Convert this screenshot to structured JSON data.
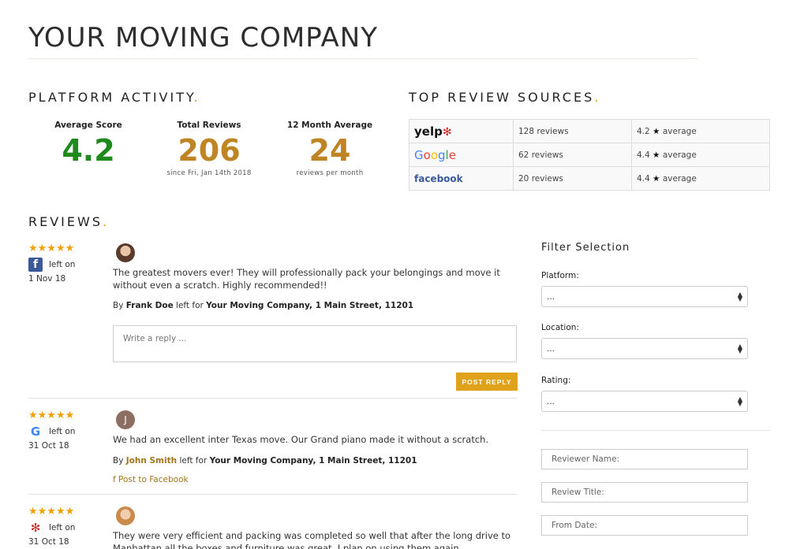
{
  "company": {
    "title": "YOUR MOVING COMPANY"
  },
  "platform_activity": {
    "title": "PLATFORM ACTIVITY",
    "stats": [
      {
        "label": "Average Score",
        "value": "4.2",
        "sub": "",
        "color": "#1e8a1e"
      },
      {
        "label": "Total Reviews",
        "value": "206",
        "sub": "since Fri, Jan 14th 2018",
        "color": "#bf8524"
      },
      {
        "label": "12 Month Average",
        "value": "24",
        "sub": "reviews per month",
        "color": "#bf8524"
      }
    ]
  },
  "top_sources": {
    "title": "TOP REVIEW SOURCES",
    "rows": [
      {
        "platform": "yelp",
        "count": "128 reviews",
        "average": "4.2",
        "average_suffix": "average"
      },
      {
        "platform": "Google",
        "count": "62 reviews",
        "average": "4.4",
        "average_suffix": "average"
      },
      {
        "platform": "facebook",
        "count": "20 reviews",
        "average": "4.4",
        "average_suffix": "average"
      }
    ]
  },
  "reviews_section": {
    "title": "REVIEWS"
  },
  "reviews": [
    {
      "stars": "★★★★★",
      "platform_icon": "facebook-icon",
      "left_on": "left on",
      "date": "1 Nov 18",
      "text": "The greatest movers ever! They will professionally pack your belongings and move it without even a scratch. Highly recommended!!",
      "by_prefix": "By",
      "author": "Frank Doe",
      "left_for": "left for",
      "location": "Your Moving Company, 1 Main Street, 11201",
      "reply_placeholder": "Write a reply ...",
      "post_reply": "POST REPLY"
    },
    {
      "stars": "★★★★★",
      "platform_icon": "google-icon",
      "left_on": "left on",
      "date": "31 Oct 18",
      "avatar_letter": "J",
      "text": "We had an excellent inter Texas move. Our Grand piano made it without a scratch.",
      "by_prefix": "By",
      "author": "John Smith",
      "left_for": "left for",
      "location": "Your Moving Company, 1 Main Street, 11201",
      "fb_link": "Post to Facebook"
    },
    {
      "stars": "★★★★★",
      "platform_icon": "yelp-icon",
      "left_on": "left on",
      "date": "31 Oct 18",
      "text": "They were very efficient and packing was completed so well that after the long drive to Manhattan all the boxes and furniture was great. I plan on using them again."
    }
  ],
  "filter": {
    "title": "Filter Selection",
    "platform_label": "Platform:",
    "platform_value": "...",
    "location_label": "Location:",
    "location_value": "...",
    "rating_label": "Rating:",
    "rating_value": "...",
    "reviewer_name_placeholder": "Reviewer Name:",
    "review_title_placeholder": "Review Title:",
    "from_date_placeholder": "From Date:"
  },
  "colors": {
    "accent": "#e0a21b",
    "gold_text": "#bf8524",
    "green": "#1e8a1e"
  }
}
